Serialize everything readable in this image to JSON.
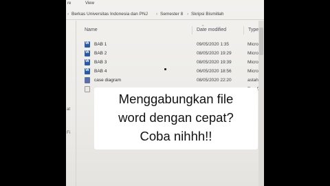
{
  "menubar": {
    "items": [
      "re",
      "View"
    ]
  },
  "address_bar": {
    "crumbs": [
      "Berkas Universitas Indonesia dan PNJ",
      "Semester 8",
      "Skripsi Bismillah"
    ],
    "separator": "›",
    "lead_arrow": "›"
  },
  "left_pane": {
    "labels": [
      "at",
      "Fi"
    ]
  },
  "columns": {
    "name": "Name",
    "date": "Date modified",
    "type": "Type"
  },
  "files": [
    {
      "name": "BAB 1",
      "date": "09/05/2020 1:35",
      "type": "Micros",
      "icon": "word-doc-icon"
    },
    {
      "name": "BAB 2",
      "date": "08/05/2020 19:29",
      "type": "Micros",
      "icon": "word-doc-icon"
    },
    {
      "name": "BAB 3",
      "date": "08/05/2020 19:39",
      "type": "Micros",
      "icon": "word-doc-icon"
    },
    {
      "name": "BAB 4",
      "date": "06/05/2020 18:56",
      "type": "Micros",
      "icon": "word-doc-icon"
    },
    {
      "name": "case diagram",
      "date": "08/05/2020 22:20",
      "type": "astah-p",
      "icon": "diagram-file-icon"
    },
    {
      "name": "",
      "date": "",
      "type": "Text Do",
      "icon": "text-file-icon"
    }
  ],
  "caption": {
    "lines": [
      "Menggabungkan file",
      "word dengan cepat?",
      "Coba nihhh!!"
    ]
  }
}
